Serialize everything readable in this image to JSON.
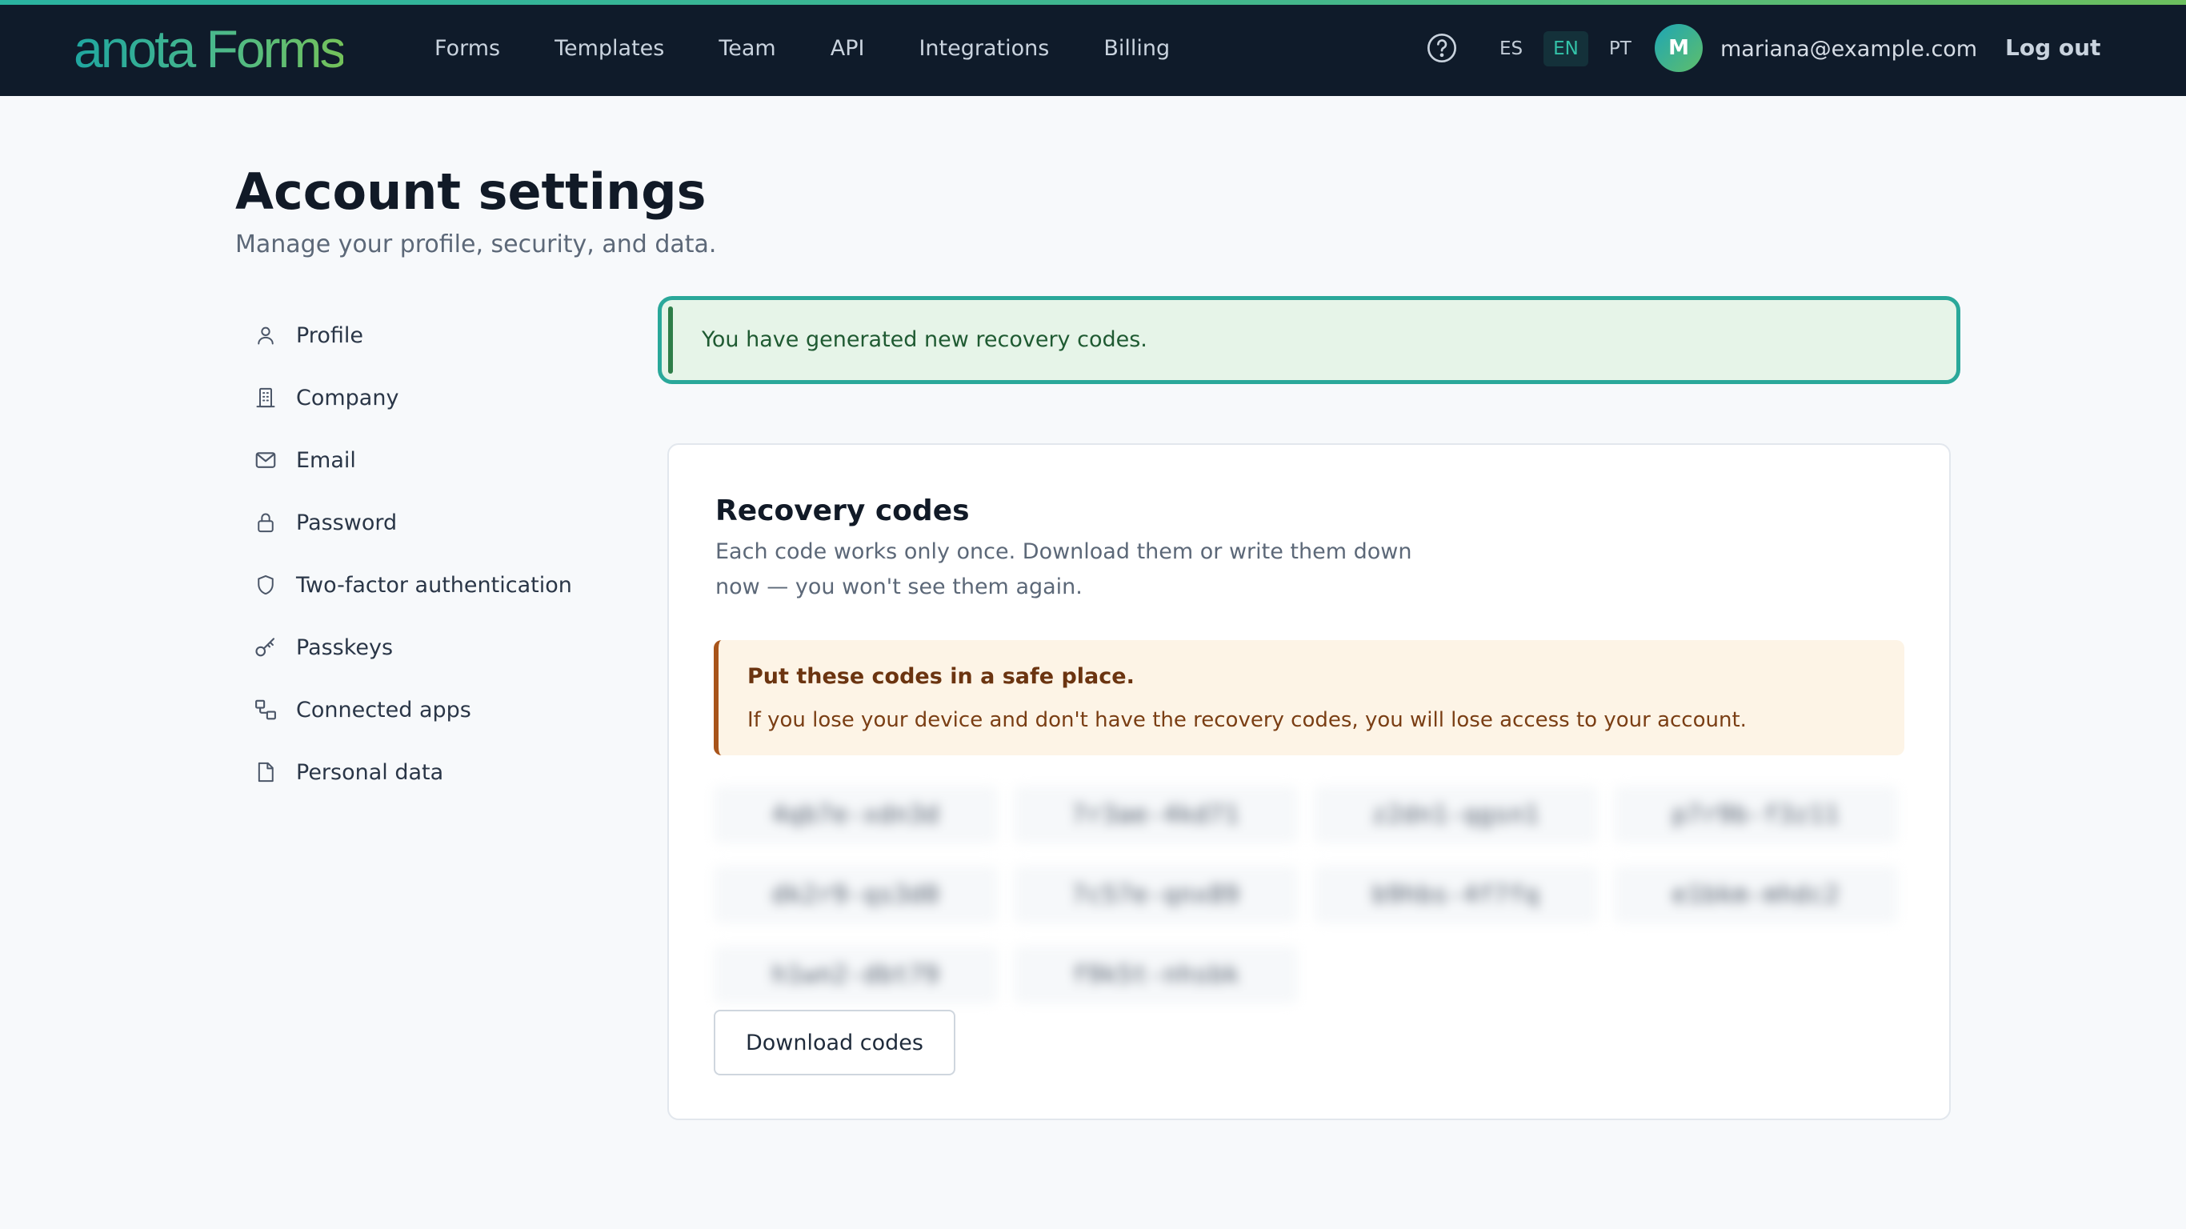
{
  "header": {
    "logo_text": "anota Forms",
    "nav": [
      {
        "label": "Forms"
      },
      {
        "label": "Templates"
      },
      {
        "label": "Team"
      },
      {
        "label": "API"
      },
      {
        "label": "Integrations"
      },
      {
        "label": "Billing"
      }
    ],
    "help_icon": "question-circle-icon",
    "languages": [
      {
        "code": "ES",
        "active": false
      },
      {
        "code": "EN",
        "active": true
      },
      {
        "code": "PT",
        "active": false
      }
    ],
    "avatar_initial": "M",
    "user_email": "mariana@example.com",
    "logout_label": "Log out"
  },
  "page": {
    "title": "Account settings",
    "subtitle": "Manage your profile, security, and data."
  },
  "sidebar": {
    "items": [
      {
        "label": "Profile",
        "icon": "user-icon"
      },
      {
        "label": "Company",
        "icon": "building-icon"
      },
      {
        "label": "Email",
        "icon": "mail-icon"
      },
      {
        "label": "Password",
        "icon": "lock-icon"
      },
      {
        "label": "Two-factor authentication",
        "icon": "shield-icon"
      },
      {
        "label": "Passkeys",
        "icon": "key-icon"
      },
      {
        "label": "Connected apps",
        "icon": "apps-icon"
      },
      {
        "label": "Personal data",
        "icon": "file-icon"
      }
    ]
  },
  "alert": {
    "message": "You have generated new recovery codes."
  },
  "recovery": {
    "title": "Recovery codes",
    "description": "Each code works only once. Download them or write them down now — you won't see them again.",
    "warning_title": "Put these codes in a safe place.",
    "warning_body": "If you lose your device and don't have the recovery codes, you will lose access to your account.",
    "codes": [
      "4qb7e-xdn3d",
      "7r3ae-4kd71",
      "z2dn1-qgsn1",
      "p7r9b-f3z11",
      "dk2r9-qs3d0",
      "7c57e-qnx89",
      "b9hbs-4f7fq",
      "e1bkm-mhdc2",
      "h1wn2-dbt79",
      "f9k5t-nhsbk"
    ],
    "download_label": "Download codes"
  },
  "colors": {
    "header_bg": "#0f1b2a",
    "accent": "#2aa89a",
    "success_bg": "#e6f4e8",
    "warning_bg": "#fdf4e6",
    "warning_border": "#a8541a"
  }
}
